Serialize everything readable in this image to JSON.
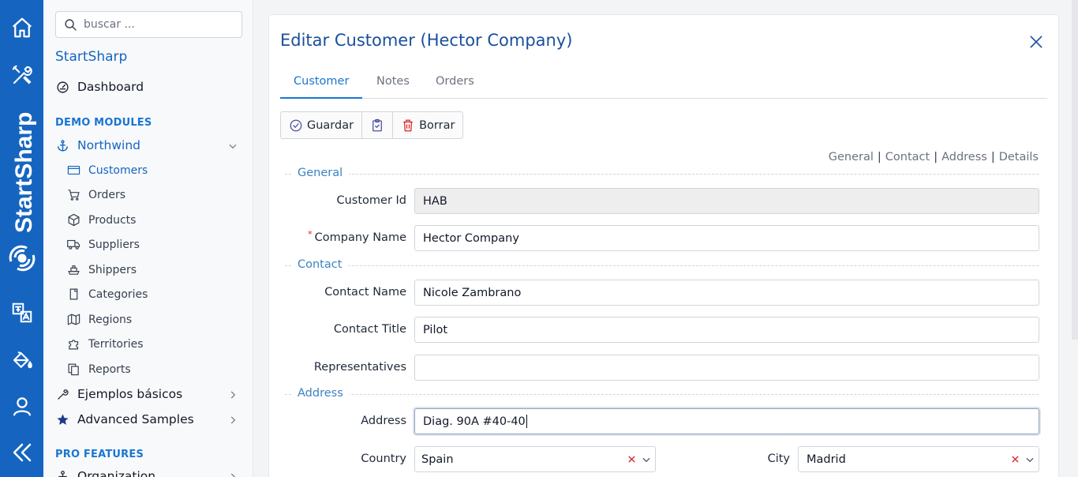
{
  "rail": {
    "brand_text": "StartSharp",
    "icons": [
      "home-icon",
      "tools-icon",
      "translate-icon",
      "paint-bucket-icon",
      "user-icon",
      "collapse-icon"
    ]
  },
  "sidebar": {
    "search_placeholder": "buscar ...",
    "app_title": "StartSharp",
    "dashboard_label": "Dashboard",
    "section_demo": "DEMO MODULES",
    "northwind_label": "Northwind",
    "northwind_items": [
      {
        "label": "Customers",
        "icon": "customers-icon"
      },
      {
        "label": "Orders",
        "icon": "cart-icon"
      },
      {
        "label": "Products",
        "icon": "box-icon"
      },
      {
        "label": "Suppliers",
        "icon": "truck-icon"
      },
      {
        "label": "Shippers",
        "icon": "ship-icon"
      },
      {
        "label": "Categories",
        "icon": "tag-icon"
      },
      {
        "label": "Regions",
        "icon": "map-icon"
      },
      {
        "label": "Territories",
        "icon": "puzzle-icon"
      },
      {
        "label": "Reports",
        "icon": "reports-icon"
      }
    ],
    "basic_samples_label": "Ejemplos básicos",
    "advanced_samples_label": "Advanced Samples",
    "section_pro": "PRO FEATURES",
    "organization_label": "Organization"
  },
  "dialog": {
    "title": "Editar Customer (Hector Company)",
    "tabs": [
      "Customer",
      "Notes",
      "Orders"
    ],
    "toolbar": {
      "save_label": "Guardar",
      "delete_label": "Borrar"
    },
    "category_links": [
      "General",
      "Contact",
      "Address",
      "Details"
    ],
    "categories": {
      "general": "General",
      "contact": "Contact",
      "address": "Address"
    },
    "fields": {
      "customer_id_label": "Customer Id",
      "customer_id_value": "HAB",
      "company_name_label": "Company Name",
      "company_name_value": "Hector Company",
      "contact_name_label": "Contact Name",
      "contact_name_value": "Nicole Zambrano",
      "contact_title_label": "Contact Title",
      "contact_title_value": "Pilot",
      "representatives_label": "Representatives",
      "representatives_value": "",
      "address_label": "Address",
      "address_value": "Diag. 90A #40-40",
      "country_label": "Country",
      "country_value": "Spain",
      "city_label": "City",
      "city_value": "Madrid"
    }
  },
  "colors": {
    "rail_bg": "#1565c0",
    "accent": "#1976d2",
    "required": "#dc2626"
  }
}
